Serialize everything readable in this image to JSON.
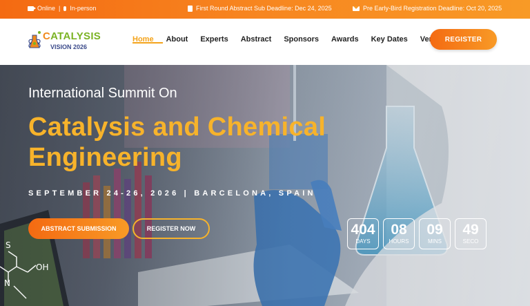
{
  "topbar": {
    "mode_online": "Online",
    "separator": "|",
    "mode_inperson": "In-person",
    "abstract_deadline": "First Round Abstract Sub Deadline: Dec 24, 2025",
    "registration_deadline": "Pre Early-Bird Registration Deadline: Oct 20, 2025"
  },
  "logo": {
    "text_c": "C",
    "text_rest": "ATALYSIS",
    "subtitle": "VISION 2026"
  },
  "nav": {
    "items": [
      "Home",
      "About",
      "Experts",
      "Abstract",
      "Sponsors",
      "Awards",
      "Key Dates",
      "Venue"
    ],
    "active": "Home",
    "register_label": "REGISTER"
  },
  "hero": {
    "subtitle": "International Summit On",
    "title": "Catalysis and Chemical Engineering",
    "date_location": "SEPTEMBER 24-26, 2026 | BARCELONA, SPAIN",
    "abstract_button": "ABSTRACT SUBMISSION",
    "register_button": "REGISTER NOW",
    "decorative_text": [
      "S",
      "N",
      "OH"
    ]
  },
  "countdown": [
    {
      "value": "404",
      "label": "DAYS"
    },
    {
      "value": "08",
      "label": "HOURS"
    },
    {
      "value": "09",
      "label": "MINS"
    },
    {
      "value": "49",
      "label": "SECO"
    }
  ],
  "colors": {
    "accent_orange": "#f46a12",
    "accent_yellow": "#f7b32b",
    "nav_active": "#f4a31a",
    "logo_green": "#7bb324",
    "logo_navy": "#3b4a8a"
  },
  "icons": [
    "video-camera-icon",
    "microphone-icon",
    "document-icon",
    "envelope-icon"
  ]
}
